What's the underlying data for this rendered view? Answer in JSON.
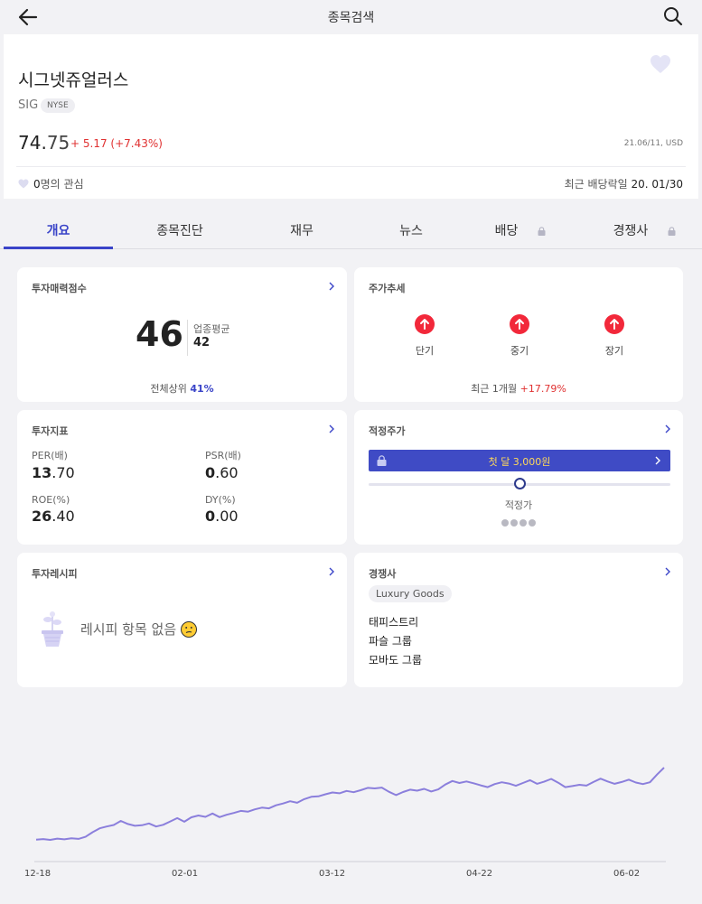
{
  "header": {
    "title": "종목검색",
    "back_icon": "arrow-left-icon",
    "search_icon": "search-icon"
  },
  "stock": {
    "name": "시그넷쥬얼러스",
    "ticker": "SIG",
    "exchange": "NYSE",
    "price_int": "74.",
    "price_dec": "75",
    "change": "+ 5.17 (+7.43%)",
    "date": "21.06/11, USD",
    "interest_count": "0",
    "interest_suffix": "명의 관심",
    "dividend_label": "최근 배당락일",
    "dividend_date": "20. 01/30"
  },
  "tabs": [
    {
      "label": "개요",
      "active": true
    },
    {
      "label": "종목진단"
    },
    {
      "label": "재무"
    },
    {
      "label": "뉴스"
    },
    {
      "label": "배당",
      "locked": true
    },
    {
      "label": "경쟁사",
      "locked": true
    }
  ],
  "score_card": {
    "title": "투자매력점수",
    "score": "46",
    "avg_label": "업종평균",
    "avg_value": "42",
    "rank_label": "전체상위",
    "rank_value": "41%"
  },
  "trend_card": {
    "title": "주가추세",
    "items": [
      {
        "label": "단기",
        "direction": "up"
      },
      {
        "label": "중기",
        "direction": "up"
      },
      {
        "label": "장기",
        "direction": "up"
      }
    ],
    "note_label": "최근 1개월",
    "note_value": "+17.79%"
  },
  "indicator_card": {
    "title": "투자지표",
    "items": [
      {
        "label": "PER(배)",
        "int": "13",
        "dec": ".70"
      },
      {
        "label": "PSR(배)",
        "int": "0",
        "dec": ".60"
      },
      {
        "label": "ROE(%)",
        "int": "26",
        "dec": ".40"
      },
      {
        "label": "DY(%)",
        "int": "0",
        "dec": ".00"
      }
    ]
  },
  "fair_card": {
    "title": "적정주가",
    "cta": "첫 달 3,000원",
    "label": "적정가",
    "slider_fraction": 0.5
  },
  "recipe_card": {
    "title": "투자레시피",
    "empty": "레시피 항목 없음"
  },
  "competitor_card": {
    "title": "경쟁사",
    "sector": "Luxury Goods",
    "items": [
      "태피스트리",
      "파슬 그룹",
      "모바도 그룹"
    ]
  },
  "colors": {
    "accent": "#3a44c8",
    "up": "#e03131",
    "line": "#8b7fdc"
  },
  "chart_data": {
    "type": "line",
    "x_ticks": [
      "12-18",
      "02-01",
      "03-12",
      "04-22",
      "06-02"
    ],
    "series": [
      {
        "values": [
          33.1,
          33.3,
          33.0,
          33.5,
          33.2,
          33.6,
          33.4,
          34.2,
          36.0,
          37.5,
          38.2,
          38.8,
          40.4,
          39.2,
          38.5,
          38.7,
          39.4,
          38.2,
          38.9,
          40.2,
          41.5,
          40.1,
          41.8,
          42.5,
          42.0,
          43.3,
          41.9,
          42.8,
          43.5,
          44.3,
          44.0,
          44.9,
          45.6,
          45.3,
          46.5,
          47.2,
          48.1,
          47.5,
          48.9,
          49.8,
          50.0,
          50.8,
          51.5,
          51.2,
          52.1,
          51.6,
          52.4,
          53.3,
          53.1,
          53.4,
          51.8,
          50.5,
          51.7,
          52.6,
          52.2,
          52.9,
          51.9,
          52.7,
          54.6,
          56.0,
          55.2,
          55.8,
          55.1,
          54.3,
          53.6,
          54.8,
          55.5,
          55.0,
          54.1,
          55.2,
          56.3,
          54.9,
          55.7,
          56.8,
          55.3,
          53.6,
          54.0,
          54.5,
          54.2,
          55.6,
          56.9,
          55.8,
          54.9,
          55.6,
          56.5,
          55.4,
          54.8,
          55.5,
          58.5,
          61.2
        ]
      }
    ]
  }
}
